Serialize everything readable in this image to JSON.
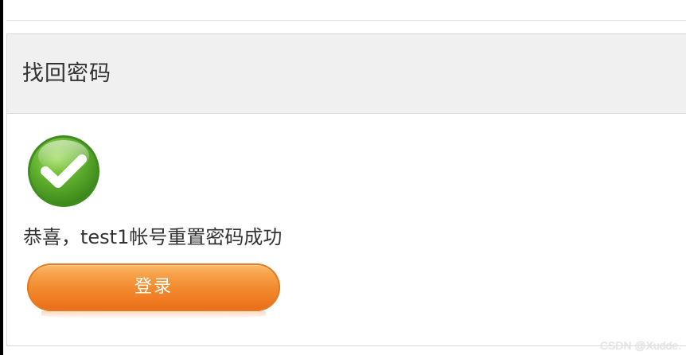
{
  "panel": {
    "title": "找回密码"
  },
  "result": {
    "icon": "check-circle-icon",
    "message": "恭喜，test1帐号重置密码成功",
    "success_color": "#5fae2d"
  },
  "actions": {
    "login_label": "登录",
    "button_color": "#f28c30"
  },
  "watermark": {
    "text": "CSDN @Xudde."
  }
}
